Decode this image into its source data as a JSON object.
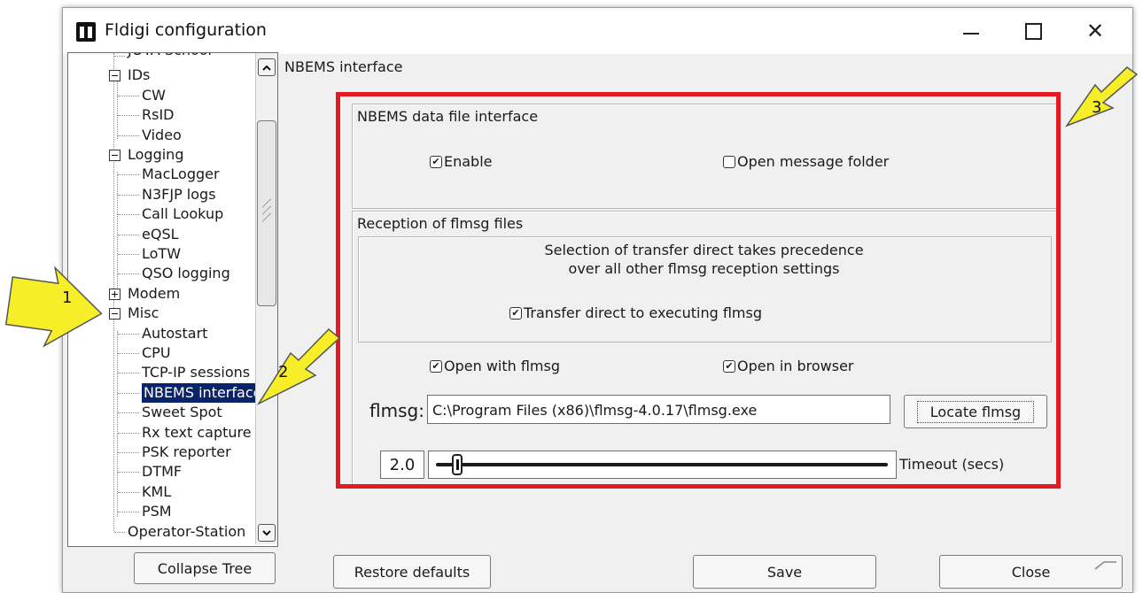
{
  "window": {
    "title": "Fldigi configuration",
    "controls": {
      "minimize": "minimize-icon",
      "maximize": "maximize-icon",
      "close": "close-icon",
      "close_glyph": "✕"
    }
  },
  "tree": {
    "items": [
      {
        "label": "JOTA School",
        "level": 1,
        "partial": true
      },
      {
        "label": "IDs",
        "level": 1,
        "expander": "minus"
      },
      {
        "label": "CW",
        "level": 2
      },
      {
        "label": "RsID",
        "level": 2
      },
      {
        "label": "Video",
        "level": 2
      },
      {
        "label": "Logging",
        "level": 1,
        "expander": "minus"
      },
      {
        "label": "MacLogger",
        "level": 2
      },
      {
        "label": "N3FJP logs",
        "level": 2
      },
      {
        "label": "Call Lookup",
        "level": 2
      },
      {
        "label": "eQSL",
        "level": 2
      },
      {
        "label": "LoTW",
        "level": 2
      },
      {
        "label": "QSO logging",
        "level": 2
      },
      {
        "label": "Modem",
        "level": 1,
        "expander": "plus"
      },
      {
        "label": "Misc",
        "level": 1,
        "expander": "minus"
      },
      {
        "label": "Autostart",
        "level": 2
      },
      {
        "label": "CPU",
        "level": 2
      },
      {
        "label": "TCP-IP sessions",
        "level": 2
      },
      {
        "label": "NBEMS interface",
        "level": 2,
        "selected": true
      },
      {
        "label": "Sweet Spot",
        "level": 2
      },
      {
        "label": "Rx text capture",
        "level": 2
      },
      {
        "label": "PSK reporter",
        "level": 2
      },
      {
        "label": "DTMF",
        "level": 2
      },
      {
        "label": "KML",
        "level": 2
      },
      {
        "label": "PSM",
        "level": 2
      },
      {
        "label": "Operator-Station",
        "level": 1
      }
    ],
    "scroll_up_icon": "chevron-up-icon",
    "scroll_down_icon": "chevron-down-icon"
  },
  "panel": {
    "title": "NBEMS interface",
    "data_file_group": {
      "label": "NBEMS data file interface",
      "enable": {
        "label": "Enable",
        "checked": true
      },
      "open_folder": {
        "label": "Open message folder",
        "checked": false
      }
    },
    "reception_group": {
      "label": "Reception of flmsg files",
      "note_line1": "Selection of transfer direct takes precedence",
      "note_line2": "over all other flmsg reception settings",
      "transfer_direct": {
        "label": "Transfer direct to executing flmsg",
        "checked": true
      },
      "open_with_flmsg": {
        "label": "Open with flmsg",
        "checked": true
      },
      "open_in_browser": {
        "label": "Open in browser",
        "checked": true
      },
      "flmsg_label": "flmsg:",
      "flmsg_path": "C:\\Program Files (x86)\\flmsg-4.0.17\\flmsg.exe",
      "locate_button": "Locate flmsg",
      "timeout_value": "2.0",
      "timeout_label": "Timeout (secs)",
      "timeout_fraction": 0.02
    }
  },
  "footer": {
    "collapse_tree": "Collapse Tree",
    "restore_defaults": "Restore defaults",
    "save": "Save",
    "close": "Close"
  },
  "annotations": {
    "callout_1": "1",
    "callout_2": "2",
    "callout_3": "3",
    "highlight_color": "#e31b23",
    "arrow_color": "#f7ee2a"
  },
  "colors": {
    "selection": "#0a246a",
    "window_bg": "#f0f0f0"
  }
}
